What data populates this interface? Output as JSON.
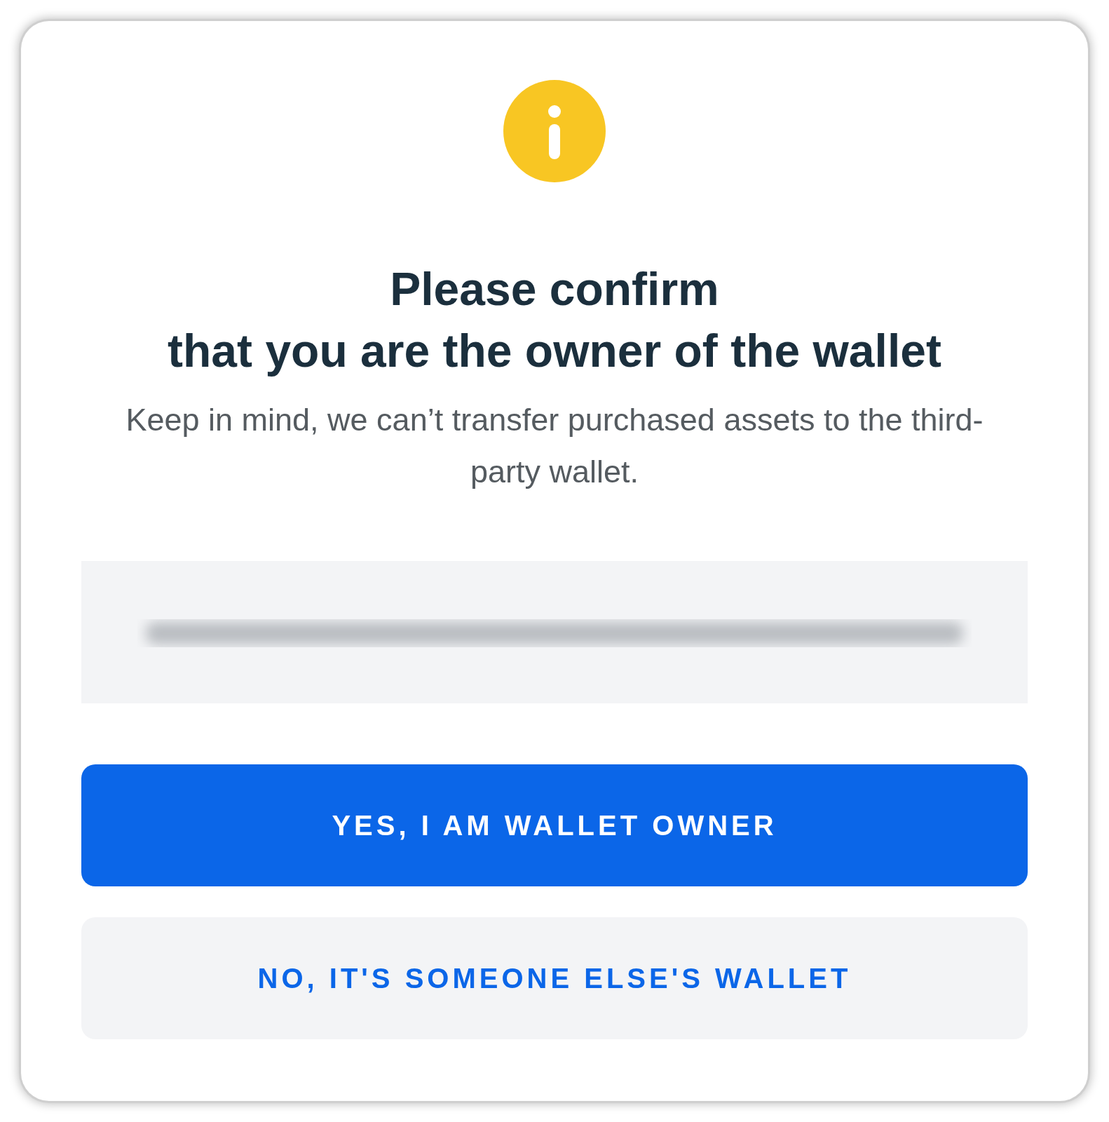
{
  "dialog": {
    "title_lines": [
      "Please confirm",
      "that you are the owner of the wallet"
    ],
    "message": "Keep in mind, we can’t transfer purchased assets to the third-party wallet.",
    "address_field": {
      "kind": "redacted"
    },
    "buttons": [
      {
        "label": "YES, I AM WALLET OWNER",
        "kind": "primary"
      },
      {
        "label": "NO, IT'S SOMEONE ELSE'S WALLET",
        "kind": "secondary"
      }
    ]
  }
}
